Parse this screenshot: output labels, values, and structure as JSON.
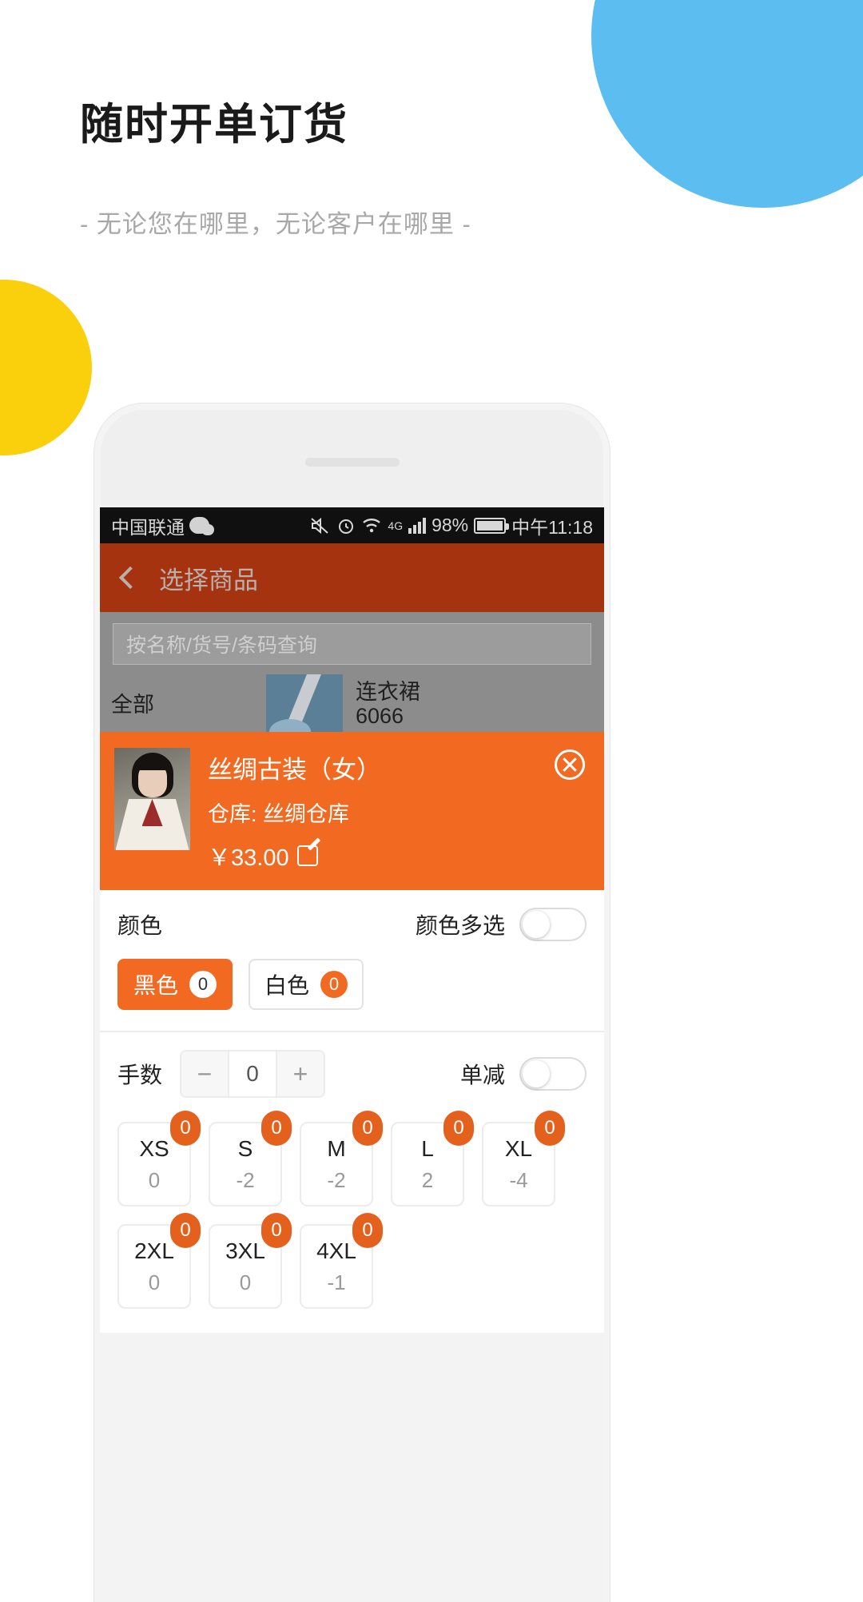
{
  "marketing": {
    "headline": "随时开单订货",
    "subhead": "- 无论您在哪里，无论客户在哪里 -"
  },
  "colors": {
    "accent_orange": "#f26a21",
    "badge_orange": "#e4601d",
    "appbar_brick": "#a6330f",
    "blob_blue": "#5bbdf0",
    "blob_yellow": "#fad00c"
  },
  "statusbar": {
    "carrier": "中国联通",
    "battery_percent": "98%",
    "network": "4G",
    "time": "中午11:18"
  },
  "appbar": {
    "title": "选择商品",
    "back_icon": "chevron-left-icon"
  },
  "search": {
    "placeholder": "按名称/货号/条码查询",
    "value": ""
  },
  "list_strip": {
    "category": "全部",
    "product_name": "连衣裙",
    "product_code": "6066"
  },
  "selected_product": {
    "title": "丝绸古装（女）",
    "warehouse": "仓库: 丝绸仓库",
    "price": "￥33.00",
    "edit_icon": "pencil-icon",
    "close_icon": "close-circle-icon"
  },
  "color_section": {
    "label": "颜色",
    "toggle_label": "颜色多选",
    "toggle_on": false,
    "options": [
      {
        "name": "黑色",
        "count": "0",
        "selected": true
      },
      {
        "name": "白色",
        "count": "0",
        "selected": false
      }
    ]
  },
  "quantity_section": {
    "label": "手数",
    "minus": "−",
    "value": "0",
    "plus": "+",
    "toggle_label": "单减",
    "toggle_on": false
  },
  "sizes": [
    {
      "name": "XS",
      "stock": "0",
      "badge": "0"
    },
    {
      "name": "S",
      "stock": "-2",
      "badge": "0"
    },
    {
      "name": "M",
      "stock": "-2",
      "badge": "0"
    },
    {
      "name": "L",
      "stock": "2",
      "badge": "0"
    },
    {
      "name": "XL",
      "stock": "-4",
      "badge": "0"
    },
    {
      "name": "2XL",
      "stock": "0",
      "badge": "0"
    },
    {
      "name": "3XL",
      "stock": "0",
      "badge": "0"
    },
    {
      "name": "4XL",
      "stock": "-1",
      "badge": "0"
    }
  ]
}
